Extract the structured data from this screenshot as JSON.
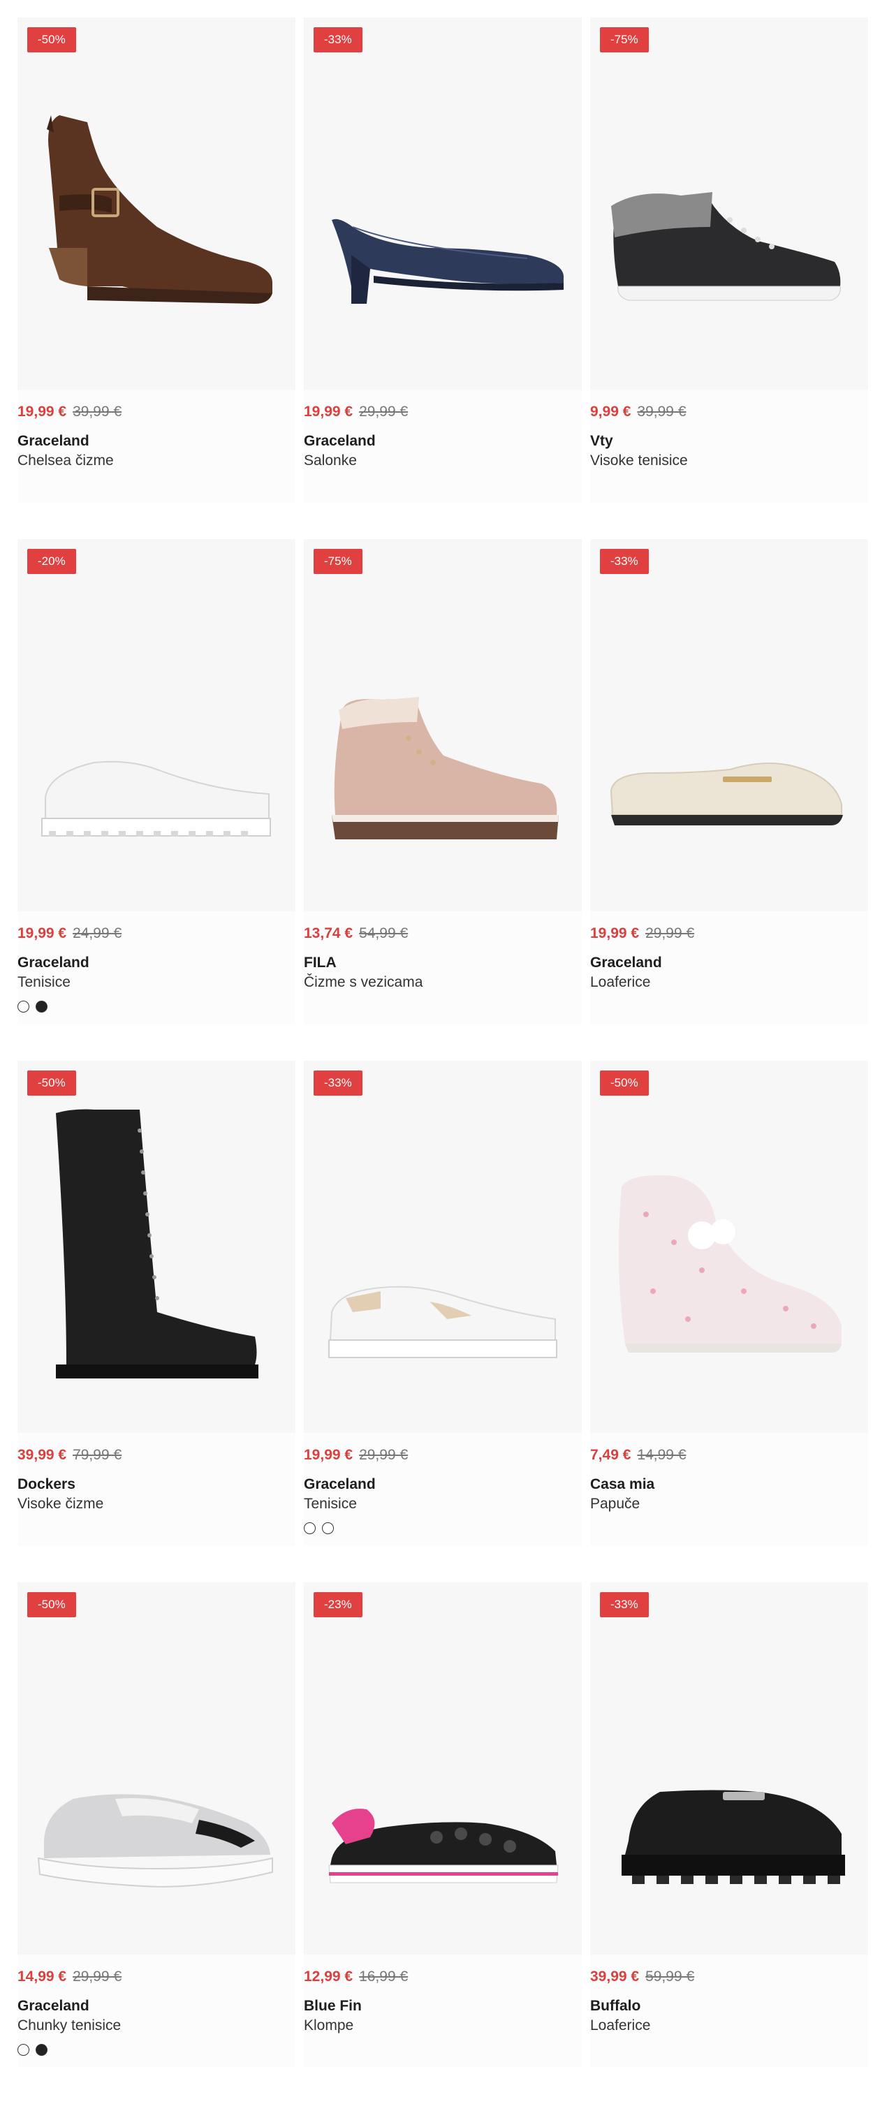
{
  "products": [
    {
      "discount": "-50%",
      "price": "19,99 €",
      "old_price": "39,99 €",
      "brand": "Graceland",
      "category": "Chelsea čizme",
      "icon": "brown-ankle-boot-icon",
      "swatches": []
    },
    {
      "discount": "-33%",
      "price": "19,99 €",
      "old_price": "29,99 €",
      "brand": "Graceland",
      "category": "Salonke",
      "icon": "navy-pump-icon",
      "swatches": []
    },
    {
      "discount": "-75%",
      "price": "9,99 €",
      "old_price": "39,99 €",
      "brand": "Vty",
      "category": "Visoke tenisice",
      "icon": "black-high-sneaker-icon",
      "swatches": []
    },
    {
      "discount": "-20%",
      "price": "19,99 €",
      "old_price": "24,99 €",
      "brand": "Graceland",
      "category": "Tenisice",
      "icon": "white-platform-sneaker-icon",
      "swatches": [
        "white",
        "black"
      ]
    },
    {
      "discount": "-75%",
      "price": "13,74 €",
      "old_price": "54,99 €",
      "brand": "FILA",
      "category": "Čizme s vezicama",
      "icon": "pink-lace-boot-icon",
      "swatches": []
    },
    {
      "discount": "-33%",
      "price": "19,99 €",
      "old_price": "29,99 €",
      "brand": "Graceland",
      "category": "Loaferice",
      "icon": "cream-loafer-icon",
      "swatches": []
    },
    {
      "discount": "-50%",
      "price": "39,99 €",
      "old_price": "79,99 €",
      "brand": "Dockers",
      "category": "Visoke čizme",
      "icon": "black-tall-boot-icon",
      "swatches": []
    },
    {
      "discount": "-33%",
      "price": "19,99 €",
      "old_price": "29,99 €",
      "brand": "Graceland",
      "category": "Tenisice",
      "icon": "white-beige-sneaker-icon",
      "swatches": [
        "white",
        "white"
      ]
    },
    {
      "discount": "-50%",
      "price": "7,49 €",
      "old_price": "14,99 €",
      "brand": "Casa mia",
      "category": "Papuče",
      "icon": "knit-slipper-icon",
      "swatches": []
    },
    {
      "discount": "-50%",
      "price": "14,99 €",
      "old_price": "29,99 €",
      "brand": "Graceland",
      "category": "Chunky tenisice",
      "icon": "silver-chunky-sneaker-icon",
      "swatches": [
        "white",
        "black"
      ]
    },
    {
      "discount": "-23%",
      "price": "12,99 €",
      "old_price": "16,99 €",
      "brand": "Blue Fin",
      "category": "Klompe",
      "icon": "black-clog-icon",
      "swatches": []
    },
    {
      "discount": "-33%",
      "price": "39,99 €",
      "old_price": "59,99 €",
      "brand": "Buffalo",
      "category": "Loaferice",
      "icon": "black-chunky-loafer-icon",
      "swatches": []
    }
  ],
  "colors": {
    "badge": "#e0403f",
    "price": "#d9403e"
  }
}
